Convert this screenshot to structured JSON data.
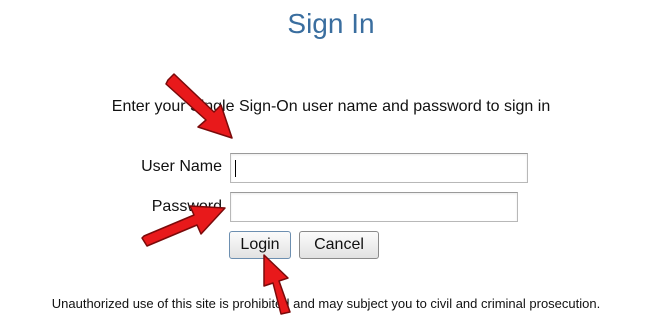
{
  "page": {
    "title": "Sign In",
    "instruction": "Enter your Single Sign-On user name and password to sign in",
    "notice": "Unauthorized use of this site is prohibited and may subject you to civil and criminal prosecution."
  },
  "form": {
    "username_label": "User Name",
    "username_value": "",
    "password_label": "Password",
    "password_value": "",
    "login_label": "Login",
    "cancel_label": "Cancel"
  },
  "annotations": {
    "arrow_color": "#e8191b",
    "count": 3
  },
  "colors": {
    "title": "#3a6e9f"
  }
}
